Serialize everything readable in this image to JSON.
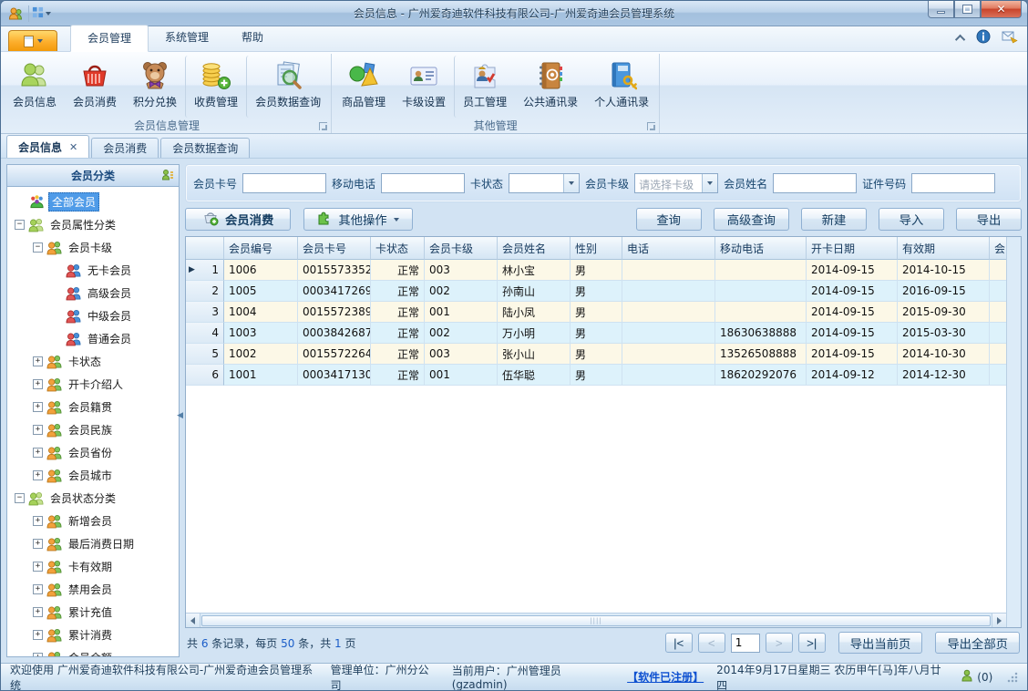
{
  "window": {
    "title": "会员信息 - 广州爱奇迪软件科技有限公司-广州爱奇迪会员管理系统"
  },
  "ribbon": {
    "tabs": [
      {
        "label": "会员管理",
        "active": true
      },
      {
        "label": "系统管理",
        "active": false
      },
      {
        "label": "帮助",
        "active": false
      }
    ],
    "groups": [
      {
        "label": "会员信息管理",
        "buttons": [
          {
            "label": "会员信息",
            "icon": "member-info-icon",
            "sep": false
          },
          {
            "label": "会员消费",
            "icon": "member-consume-icon",
            "sep": false
          },
          {
            "label": "积分兑换",
            "icon": "points-exchange-icon",
            "sep": false
          },
          {
            "label": "收费管理",
            "icon": "fee-management-icon",
            "sep": true
          },
          {
            "label": "会员数据查询",
            "icon": "member-data-query-icon",
            "sep": true
          }
        ]
      },
      {
        "label": "其他管理",
        "buttons": [
          {
            "label": "商品管理",
            "icon": "goods-management-icon",
            "sep": false
          },
          {
            "label": "卡级设置",
            "icon": "card-level-settings-icon",
            "sep": false
          },
          {
            "label": "员工管理",
            "icon": "staff-management-icon",
            "sep": true
          },
          {
            "label": "公共通讯录",
            "icon": "public-contacts-icon",
            "sep": false
          },
          {
            "label": "个人通讯录",
            "icon": "personal-contacts-icon",
            "sep": false
          }
        ]
      }
    ]
  },
  "doc_tabs": [
    {
      "label": "会员信息",
      "active": true,
      "closable": true
    },
    {
      "label": "会员消费",
      "active": false,
      "closable": false
    },
    {
      "label": "会员数据查询",
      "active": false,
      "closable": false
    }
  ],
  "sidebar": {
    "header": "会员分类",
    "tree": [
      {
        "label": "全部会员",
        "depth": 0,
        "exp": "",
        "icon": "all-members-icon",
        "selected": true
      },
      {
        "label": "会员属性分类",
        "depth": 0,
        "exp": "-",
        "icon": "people-green-icon",
        "selected": false
      },
      {
        "label": "会员卡级",
        "depth": 1,
        "exp": "-",
        "icon": "people-orange-icon",
        "selected": false
      },
      {
        "label": "无卡会员",
        "depth": 2,
        "exp": "",
        "icon": "people-redblue-icon",
        "selected": false
      },
      {
        "label": "高级会员",
        "depth": 2,
        "exp": "",
        "icon": "people-redblue-icon",
        "selected": false
      },
      {
        "label": "中级会员",
        "depth": 2,
        "exp": "",
        "icon": "people-redblue-icon",
        "selected": false
      },
      {
        "label": "普通会员",
        "depth": 2,
        "exp": "",
        "icon": "people-redblue-icon",
        "selected": false
      },
      {
        "label": "卡状态",
        "depth": 1,
        "exp": "+",
        "icon": "people-orange-icon",
        "selected": false
      },
      {
        "label": "开卡介绍人",
        "depth": 1,
        "exp": "+",
        "icon": "people-orange-icon",
        "selected": false
      },
      {
        "label": "会员籍贯",
        "depth": 1,
        "exp": "+",
        "icon": "people-orange-icon",
        "selected": false
      },
      {
        "label": "会员民族",
        "depth": 1,
        "exp": "+",
        "icon": "people-orange-icon",
        "selected": false
      },
      {
        "label": "会员省份",
        "depth": 1,
        "exp": "+",
        "icon": "people-orange-icon",
        "selected": false
      },
      {
        "label": "会员城市",
        "depth": 1,
        "exp": "+",
        "icon": "people-orange-icon",
        "selected": false
      },
      {
        "label": "会员状态分类",
        "depth": 0,
        "exp": "-",
        "icon": "people-green-icon",
        "selected": false
      },
      {
        "label": "新增会员",
        "depth": 1,
        "exp": "+",
        "icon": "people-orange-icon",
        "selected": false
      },
      {
        "label": "最后消费日期",
        "depth": 1,
        "exp": "+",
        "icon": "people-orange-icon",
        "selected": false
      },
      {
        "label": "卡有效期",
        "depth": 1,
        "exp": "+",
        "icon": "people-orange-icon",
        "selected": false
      },
      {
        "label": "禁用会员",
        "depth": 1,
        "exp": "+",
        "icon": "people-orange-icon",
        "selected": false
      },
      {
        "label": "累计充值",
        "depth": 1,
        "exp": "+",
        "icon": "people-orange-icon",
        "selected": false
      },
      {
        "label": "累计消费",
        "depth": 1,
        "exp": "+",
        "icon": "people-orange-icon",
        "selected": false
      },
      {
        "label": "会员余额",
        "depth": 1,
        "exp": "+",
        "icon": "people-orange-icon",
        "selected": false
      }
    ]
  },
  "filters": [
    {
      "label": "会员卡号",
      "type": "text",
      "value": ""
    },
    {
      "label": "移动电话",
      "type": "text",
      "value": ""
    },
    {
      "label": "卡状态",
      "type": "combo",
      "value": "",
      "placeholder": false
    },
    {
      "label": "会员卡级",
      "type": "combo",
      "value": "请选择卡级",
      "placeholder": true
    },
    {
      "label": "会员姓名",
      "type": "text",
      "value": ""
    },
    {
      "label": "证件号码",
      "type": "text",
      "value": ""
    }
  ],
  "toolbar": {
    "member_consume": "会员消费",
    "other_ops": "其他操作",
    "buttons": [
      "查询",
      "高级查询",
      "新建",
      "导入",
      "导出"
    ]
  },
  "grid": {
    "columns": [
      "",
      "会员编号",
      "会员卡号",
      "卡状态",
      "会员卡级",
      "会员姓名",
      "性别",
      "电话",
      "移动电话",
      "开卡日期",
      "有效期",
      "会员"
    ],
    "rows": [
      [
        "1",
        "1006",
        "0015573352",
        "正常",
        "003",
        "林小宝",
        "男",
        "",
        "",
        "2014-09-15",
        "2014-10-15",
        ""
      ],
      [
        "2",
        "1005",
        "0003417269",
        "正常",
        "002",
        "孙南山",
        "男",
        "",
        "",
        "2014-09-15",
        "2016-09-15",
        ""
      ],
      [
        "3",
        "1004",
        "0015572389",
        "正常",
        "001",
        "陆小凤",
        "男",
        "",
        "",
        "2014-09-15",
        "2015-09-30",
        ""
      ],
      [
        "4",
        "1003",
        "0003842687",
        "正常",
        "002",
        "万小明",
        "男",
        "",
        "18630638888",
        "2014-09-15",
        "2015-03-30",
        ""
      ],
      [
        "5",
        "1002",
        "0015572264",
        "正常",
        "003",
        "张小山",
        "男",
        "",
        "13526508888",
        "2014-09-15",
        "2014-10-30",
        ""
      ],
      [
        "6",
        "1001",
        "0003417130",
        "正常",
        "001",
        "伍华聪",
        "男",
        "",
        "18620292076",
        "2014-09-12",
        "2014-12-30",
        ""
      ]
    ]
  },
  "pager": {
    "summary_segments": [
      "共 ",
      "6",
      " 条记录，每页 ",
      "50",
      " 条，共 ",
      "1",
      " 页"
    ],
    "first": "|<",
    "prev": "<",
    "page_value": "1",
    "next": ">",
    "last": ">|",
    "export_current": "导出当前页",
    "export_all": "导出全部页"
  },
  "statusbar": {
    "welcome": "欢迎使用 广州爱奇迪软件科技有限公司-广州爱奇迪会员管理系统",
    "unit": "管理单位：广州分公司",
    "user": "当前用户：广州管理员(gzadmin)",
    "registered": "【软件已注册】",
    "datetime": "2014年9月17日星期三 农历甲午[马]年八月廿四",
    "online_count": "(0)"
  }
}
